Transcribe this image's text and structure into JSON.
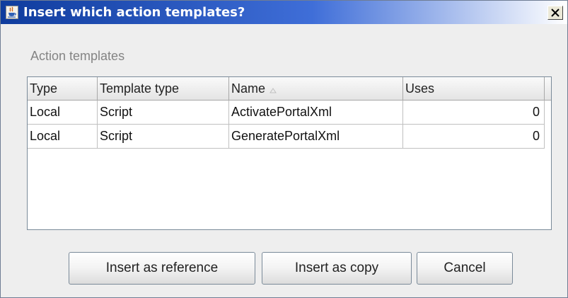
{
  "window": {
    "title": "Insert which action templates?",
    "icon": "java-cup-icon",
    "close_icon": "close-icon"
  },
  "section": {
    "label": "Action templates"
  },
  "table": {
    "columns": [
      {
        "label": "Type"
      },
      {
        "label": "Template type"
      },
      {
        "label": "Name",
        "sort": "ascending",
        "sort_icon": "sort-ascending-icon"
      },
      {
        "label": "Uses"
      }
    ],
    "rows": [
      {
        "type": "Local",
        "template_type": "Script",
        "name": "ActivatePortalXml",
        "uses": "0"
      },
      {
        "type": "Local",
        "template_type": "Script",
        "name": "GeneratePortalXml",
        "uses": "0"
      }
    ]
  },
  "buttons": {
    "insert_reference": "Insert as reference",
    "insert_copy": "Insert as copy",
    "cancel": "Cancel"
  },
  "colors": {
    "titlebar_start": "#0f3c9e",
    "titlebar_end": "#ffffff",
    "dialog_background": "#eeeeee"
  }
}
